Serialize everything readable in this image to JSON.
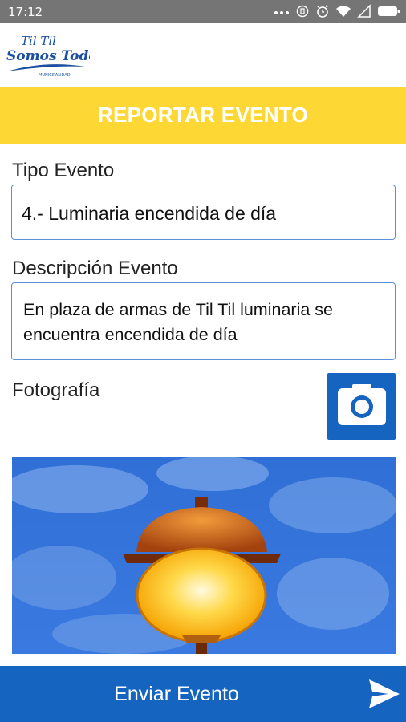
{
  "status_bar": {
    "time": "17:12"
  },
  "logo": {
    "line1": "Til Til",
    "line2": "Somos Todos!",
    "line3": "MUNICIPALIDAD"
  },
  "header": {
    "title": "REPORTAR EVENTO"
  },
  "form": {
    "tipo_label": "Tipo Evento",
    "tipo_value": "4.- Luminaria encendida de día",
    "descripcion_label": "Descripción Evento",
    "descripcion_value": "En plaza de armas de Til Til luminaria se encuentra encendida de día",
    "foto_label": "Fotografía"
  },
  "footer": {
    "send_label": "Enviar Evento"
  },
  "icons": {
    "camera": "camera-icon",
    "send": "send-icon"
  },
  "colors": {
    "banner": "#fdd835",
    "primary": "#1565c0",
    "status_bar": "#757575",
    "field_border": "#5b8fd8"
  }
}
